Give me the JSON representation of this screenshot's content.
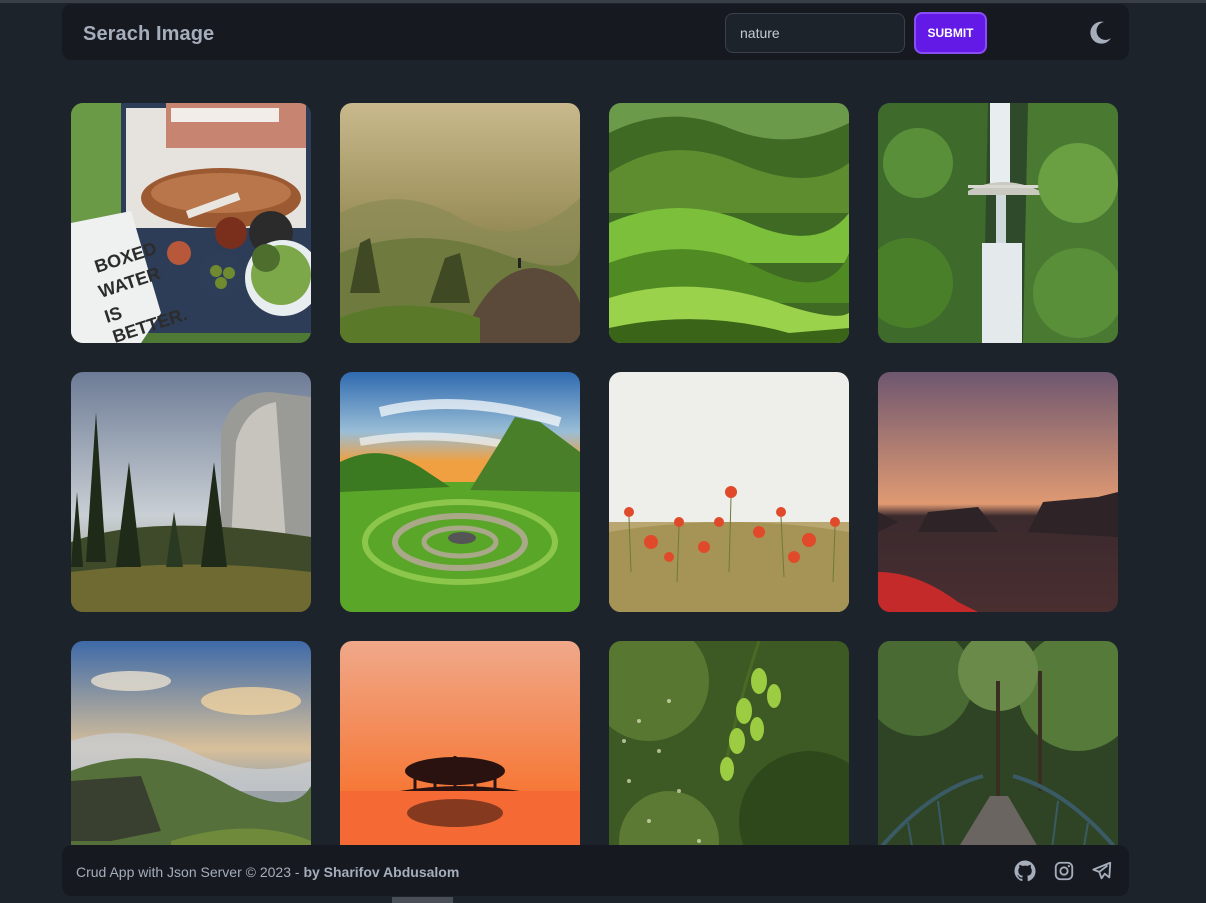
{
  "header": {
    "title": "Serach Image",
    "search": {
      "value": "nature"
    },
    "submit_label": "SUBMIT",
    "theme_icon": "moon-icon"
  },
  "gallery": {
    "images": [
      {
        "subject": "picnic-basket"
      },
      {
        "subject": "misty-mountains"
      },
      {
        "subject": "green-hills"
      },
      {
        "subject": "waterfall-bridge"
      },
      {
        "subject": "yosemite-valley"
      },
      {
        "subject": "stone-circle-field"
      },
      {
        "subject": "poppy-field"
      },
      {
        "subject": "desert-dusk"
      },
      {
        "subject": "cloudy-cliffs"
      },
      {
        "subject": "sunset-lake"
      },
      {
        "subject": "green-leaves-bokeh"
      },
      {
        "subject": "forest-bridge"
      }
    ]
  },
  "footer": {
    "text": "Crud App with Json Server © 2023 - ",
    "author": "by Sharifov Abdusalom",
    "icons": [
      "github-icon",
      "instagram-icon",
      "telegram-icon"
    ]
  },
  "colors": {
    "background": "#1d232a",
    "navbar": "#161a20",
    "primary": "#641ae6",
    "text": "#a6adbb"
  }
}
